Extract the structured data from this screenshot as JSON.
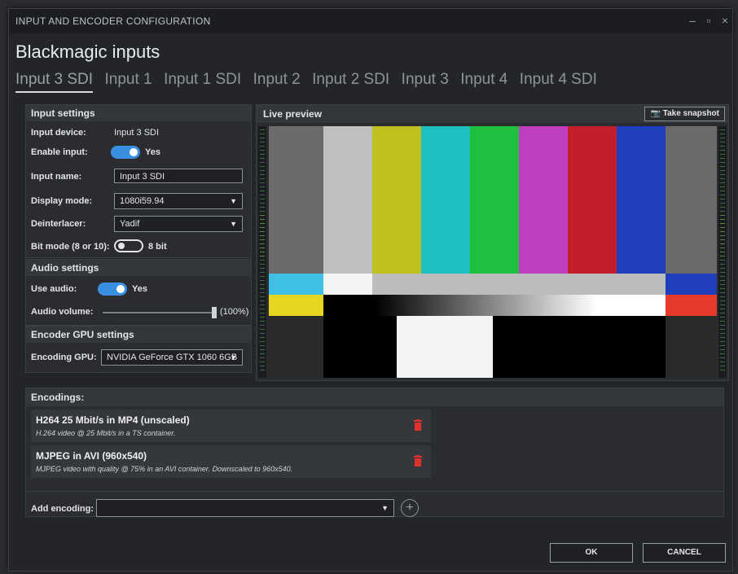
{
  "window": {
    "title": "INPUT AND ENCODER CONFIGURATION"
  },
  "heading": "Blackmagic inputs",
  "tabs": [
    "Input 3 SDI",
    "Input 1",
    "Input 1 SDI",
    "Input 2",
    "Input 2 SDI",
    "Input 3",
    "Input 4",
    "Input 4 SDI"
  ],
  "input_settings": {
    "header": "Input settings",
    "device_label": "Input device:",
    "device_value": "Input 3 SDI",
    "enable_label": "Enable input:",
    "enable_value": "Yes",
    "name_label": "Input name:",
    "name_value": "Input 3 SDI",
    "display_label": "Display mode:",
    "display_value": "1080i59.94",
    "deint_label": "Deinterlacer:",
    "deint_value": "Yadif",
    "bitmode_label": "Bit mode (8 or 10):",
    "bitmode_value": "8 bit"
  },
  "audio_settings": {
    "header": "Audio settings",
    "use_label": "Use audio:",
    "use_value": "Yes",
    "volume_label": "Audio volume:",
    "volume_value": "(100%)",
    "volume_level": 1.0
  },
  "gpu_settings": {
    "header": "Encoder GPU settings",
    "gpu_label": "Encoding GPU:",
    "gpu_value": "NVIDIA GeForce GTX 1060 6GB"
  },
  "preview": {
    "header": "Live preview",
    "snapshot_label": "Take snapshot"
  },
  "encodings": {
    "header": "Encodings:",
    "items": [
      {
        "title": "H264 25 Mbit/s in MP4 (unscaled)",
        "desc": "H.264 video @ 25 Mbit/s in a TS container."
      },
      {
        "title": "MJPEG in AVI (960x540)",
        "desc": "MJPEG video with quality @ 75% in an AVI container. Downscaled to 960x540."
      }
    ],
    "add_label": "Add encoding:",
    "add_value": ""
  },
  "buttons": {
    "ok": "OK",
    "cancel": "CANCEL"
  },
  "colors": {
    "accent": "#3b8fe0",
    "delete": "#e0302a"
  }
}
